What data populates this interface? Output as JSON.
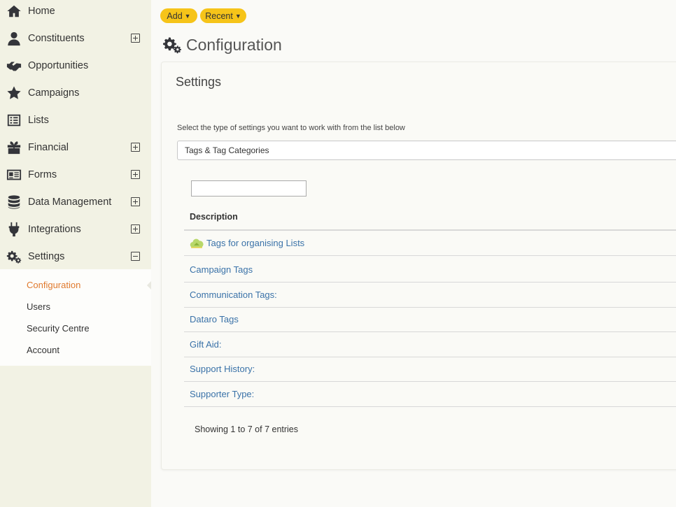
{
  "sidebar": {
    "items": [
      {
        "label": "Home",
        "icon": "home-icon",
        "expander": "none"
      },
      {
        "label": "Constituents",
        "icon": "user-icon",
        "expander": "plus"
      },
      {
        "label": "Opportunities",
        "icon": "handshake-icon",
        "expander": "none"
      },
      {
        "label": "Campaigns",
        "icon": "star-icon",
        "expander": "none"
      },
      {
        "label": "Lists",
        "icon": "list-icon",
        "expander": "none"
      },
      {
        "label": "Financial",
        "icon": "gift-icon",
        "expander": "plus"
      },
      {
        "label": "Forms",
        "icon": "id-card-icon",
        "expander": "plus"
      },
      {
        "label": "Data Management",
        "icon": "database-icon",
        "expander": "plus"
      },
      {
        "label": "Integrations",
        "icon": "plug-icon",
        "expander": "plus"
      },
      {
        "label": "Settings",
        "icon": "cogs-icon",
        "expander": "minus"
      }
    ],
    "submenu": [
      {
        "label": "Configuration",
        "active": true
      },
      {
        "label": "Users",
        "active": false
      },
      {
        "label": "Security Centre",
        "active": false
      },
      {
        "label": "Account",
        "active": false
      }
    ]
  },
  "toolbar": {
    "add_label": "Add",
    "recent_label": "Recent"
  },
  "page": {
    "title": "Configuration"
  },
  "panel": {
    "title": "Settings",
    "instruction": "Select the type of settings you want to work with from the list below",
    "selected_setting": "Tags & Tag Categories",
    "filter_value": "",
    "table": {
      "header": "Description",
      "rows": [
        {
          "label": "Tags for organising Lists",
          "icon": "cloud-tag-icon"
        },
        {
          "label": "Campaign Tags"
        },
        {
          "label": "Communication Tags:"
        },
        {
          "label": "Dataro Tags"
        },
        {
          "label": "Gift Aid:"
        },
        {
          "label": "Support History:"
        },
        {
          "label": "Supporter Type:"
        }
      ],
      "info": "Showing 1 to 7 of 7 entries"
    }
  },
  "colors": {
    "accent": "#f6c419",
    "link": "#3a72a8",
    "active_submenu": "#e07a2e",
    "sidebar_bg": "#f2f2e4"
  }
}
